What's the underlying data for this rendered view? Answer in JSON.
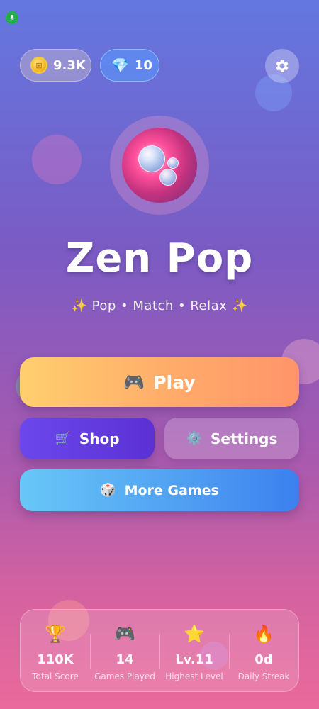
{
  "header": {
    "coins": "9.3K",
    "gems": "10",
    "coin_icon": "coin-icon",
    "gem_icon": "gem-icon",
    "settings_icon": "gear-icon"
  },
  "game": {
    "title": "Zen Pop",
    "subtitle": "✨ Pop • Match • Relax ✨"
  },
  "menu": {
    "play": {
      "icon": "🎮",
      "label": "Play"
    },
    "shop": {
      "icon": "🛒",
      "label": "Shop"
    },
    "settings": {
      "icon": "⚙️",
      "label": "Settings"
    },
    "more": {
      "icon": "🎲",
      "label": "More Games"
    }
  },
  "stats": [
    {
      "icon": "🏆",
      "value": "110K",
      "label": "Total Score"
    },
    {
      "icon": "🎮",
      "value": "14",
      "label": "Games Played"
    },
    {
      "icon": "⭐",
      "value": "Lv.11",
      "label": "Highest Level"
    },
    {
      "icon": "🔥",
      "value": "0d",
      "label": "Daily Streak"
    }
  ],
  "colors": {
    "play_start": "#ffcf6e",
    "play_end": "#ff946a",
    "shop": "#6b47ec",
    "more_start": "#69c7f7",
    "more_end": "#3c80ee"
  }
}
